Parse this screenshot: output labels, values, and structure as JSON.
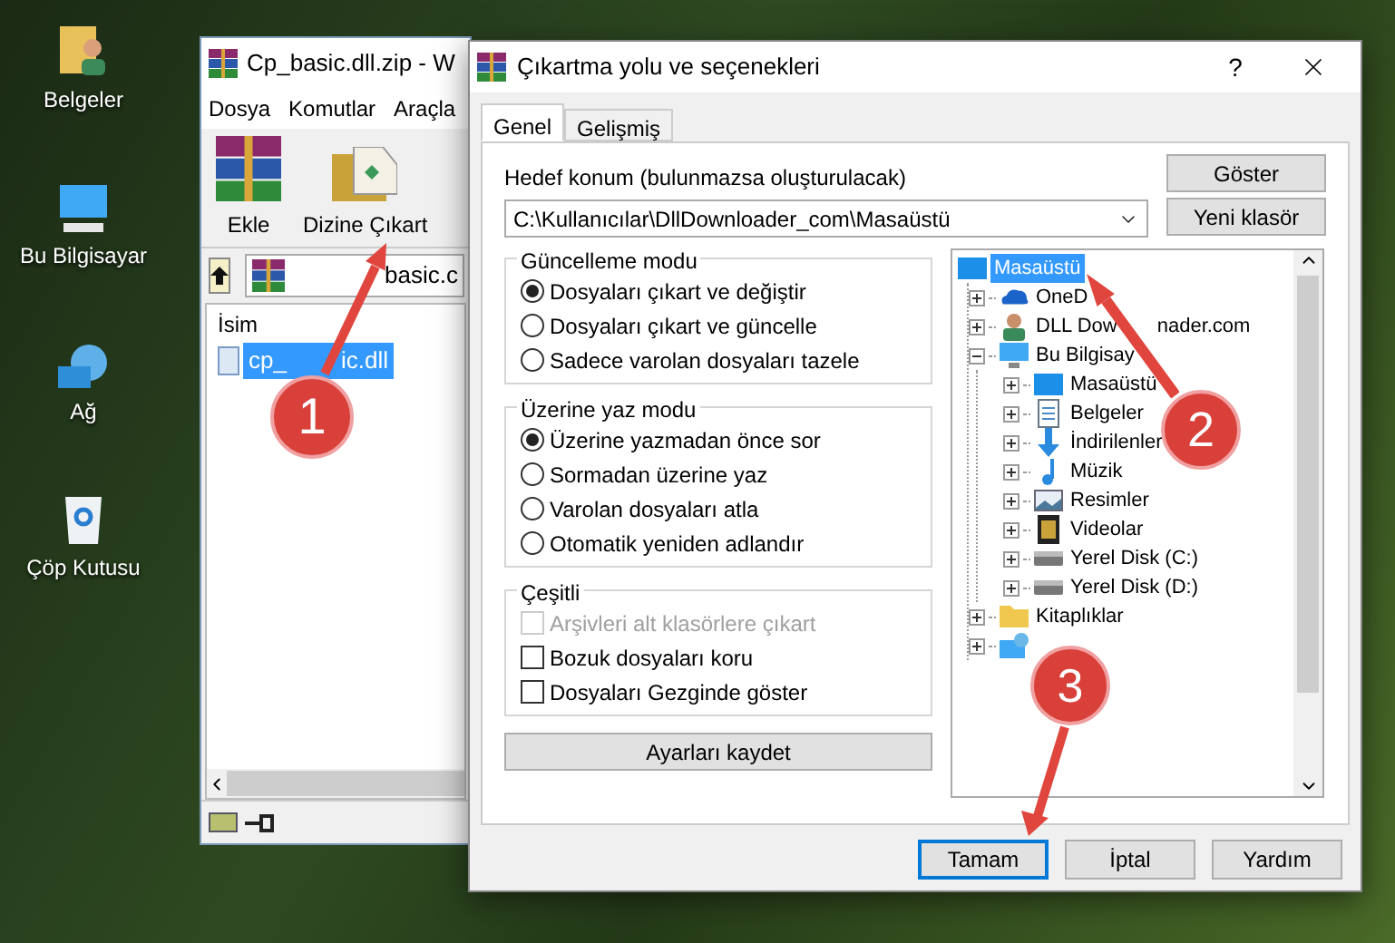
{
  "desktop": {
    "icons": [
      {
        "kind": "documents",
        "label": "Belgeler"
      },
      {
        "kind": "computer",
        "label": "Bu Bilgisayar"
      },
      {
        "kind": "network",
        "label": "Ağ"
      },
      {
        "kind": "recycle",
        "label": "Çöp Kutusu"
      }
    ]
  },
  "archive_window": {
    "title": "Cp_basic.dll.zip - W",
    "menu": [
      "Dosya",
      "Komutlar",
      "Araçla"
    ],
    "toolbar": [
      {
        "kind": "add",
        "label": "Ekle"
      },
      {
        "kind": "extract",
        "label": "Dizine Çıkart"
      }
    ],
    "address": "basic.c",
    "columns": [
      "İsim"
    ],
    "files": [
      {
        "name": "cp_",
        "name_tail": "ic.dll",
        "selected": true
      }
    ]
  },
  "dialog": {
    "title": "Çıkartma yolu ve seçenekleri",
    "help": "?",
    "tabs": [
      {
        "label": "Genel",
        "selected": true
      },
      {
        "label": "Gelişmiş",
        "selected": false
      }
    ],
    "destination_label": "Hedef konum (bulunmazsa oluşturulacak)",
    "destination": "C:\\Kullanıcılar\\DllDownloader_com\\Masaüstü",
    "side_buttons": [
      "Göster",
      "Yeni klasör"
    ],
    "groups": [
      {
        "title": "Güncelleme modu",
        "options": [
          {
            "kind": "radio",
            "label": "Dosyaları çıkart ve değiştir",
            "checked": true,
            "disabled": false
          },
          {
            "kind": "radio",
            "label": "Dosyaları çıkart ve güncelle",
            "checked": false,
            "disabled": false
          },
          {
            "kind": "radio",
            "label": "Sadece varolan dosyaları tazele",
            "checked": false,
            "disabled": false
          }
        ]
      },
      {
        "title": "Üzerine yaz modu",
        "options": [
          {
            "kind": "radio",
            "label": "Üzerine yazmadan önce sor",
            "checked": true,
            "disabled": false
          },
          {
            "kind": "radio",
            "label": "Sormadan üzerine yaz",
            "checked": false,
            "disabled": false
          },
          {
            "kind": "radio",
            "label": "Varolan dosyaları atla",
            "checked": false,
            "disabled": false
          },
          {
            "kind": "radio",
            "label": "Otomatik yeniden adlandır",
            "checked": false,
            "disabled": false
          }
        ]
      },
      {
        "title": "Çeşitli",
        "options": [
          {
            "kind": "checkbox",
            "label": "Arşivleri alt klasörlere çıkart",
            "checked": false,
            "disabled": true
          },
          {
            "kind": "checkbox",
            "label": "Bozuk dosyaları koru",
            "checked": false,
            "disabled": false
          },
          {
            "kind": "checkbox",
            "label": "Dosyaları Gezginde göster",
            "checked": false,
            "disabled": false
          }
        ]
      }
    ],
    "save_button": "Ayarları kaydet",
    "tree": [
      {
        "kind": "desktop",
        "label": "Masaüstü",
        "selected": true,
        "children": [
          {
            "kind": "cloud",
            "label": "OneD",
            "selected": false,
            "expanded": false
          },
          {
            "kind": "user",
            "label": "DLL Dow",
            "label_tail": "nader.com",
            "selected": false,
            "expanded": false
          },
          {
            "kind": "computer",
            "label": "Bu Bilgisay",
            "selected": false,
            "expanded": true,
            "children": [
              {
                "kind": "desktop",
                "label": "Masaüstü",
                "selected": false,
                "expanded": false
              },
              {
                "kind": "document",
                "label": "Belgeler",
                "selected": false,
                "expanded": false
              },
              {
                "kind": "download",
                "label": "İndirilenler",
                "selected": false,
                "expanded": false
              },
              {
                "kind": "music",
                "label": "Müzik",
                "selected": false,
                "expanded": false
              },
              {
                "kind": "picture",
                "label": "Resimler",
                "selected": false,
                "expanded": false
              },
              {
                "kind": "video",
                "label": "Videolar",
                "selected": false,
                "expanded": false
              },
              {
                "kind": "drive",
                "label": "Yerel Disk (C:)",
                "selected": false,
                "expanded": false
              },
              {
                "kind": "drive",
                "label": "Yerel Disk (D:)",
                "selected": false,
                "expanded": false
              }
            ]
          },
          {
            "kind": "folder",
            "label": "Kitaplıklar",
            "selected": false,
            "expanded": false
          },
          {
            "kind": "network",
            "selected": false,
            "expanded": false
          }
        ]
      }
    ],
    "buttons": [
      {
        "label": "Tamam",
        "default": true
      },
      {
        "label": "İptal",
        "default": false
      },
      {
        "label": "Yardım",
        "default": false
      }
    ]
  },
  "annotations": [
    {
      "number": "1"
    },
    {
      "number": "2"
    },
    {
      "number": "3"
    }
  ]
}
